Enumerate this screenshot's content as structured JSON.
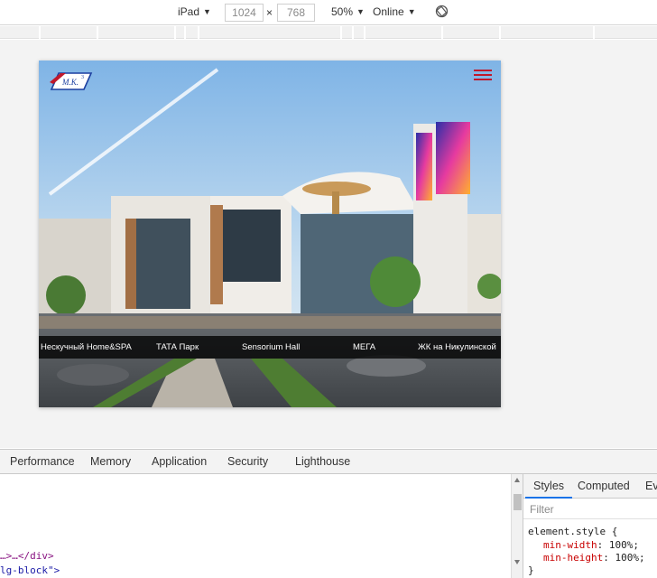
{
  "device_toolbar": {
    "device": "iPad",
    "width": "1024",
    "times": "×",
    "height": "768",
    "zoom": "50%",
    "network": "Online",
    "rotate_icon": "rotate-icon"
  },
  "site": {
    "logo_text": "М.К.",
    "logo_sup": "3",
    "menu_icon": "hamburger-icon",
    "projects": [
      "Нескучный Home&SPA",
      "ТАТА Парк",
      "Sensorium Hall",
      "МЕГА",
      "ЖК на Никулинской"
    ],
    "colors": {
      "accent": "#c0182b",
      "logo_blue": "#1c3fa0",
      "nav_bg": "#000000"
    }
  },
  "devtools": {
    "tabs": [
      "Performance",
      "Memory",
      "Application",
      "Security",
      "Lighthouse"
    ],
    "elements": {
      "line1_dots": "…",
      "line1_tail": ">…</div>",
      "line2": "lg-block\">"
    },
    "styles": {
      "tabs": [
        "Styles",
        "Computed",
        "Ev"
      ],
      "filter_placeholder": "Filter",
      "selector": "element.style {",
      "rules": [
        {
          "prop": "min-width",
          "value": "100%;"
        },
        {
          "prop": "min-height",
          "value": "100%;"
        }
      ],
      "close": "}"
    }
  }
}
